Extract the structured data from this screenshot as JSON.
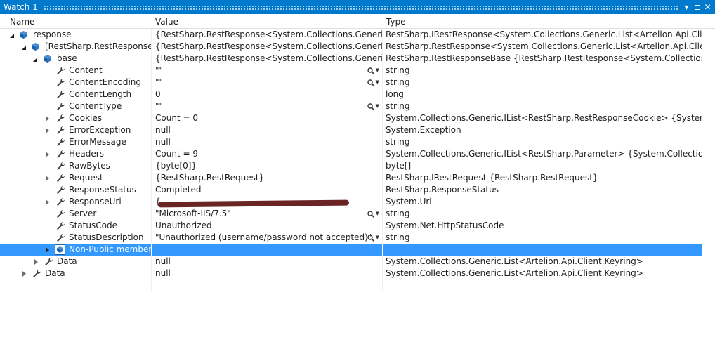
{
  "window": {
    "title": "Watch 1"
  },
  "columns": {
    "name": "Name",
    "value": "Value",
    "type": "Type"
  },
  "rows": [
    {
      "name": "response",
      "value": "{RestSharp.RestResponse<System.Collections.Generic.List<Ar",
      "type": "RestSharp.IRestResponse<System.Collections.Generic.List<Artelion.Api.Client.Keyring"
    },
    {
      "name": "[RestSharp.RestResponse<Sy",
      "value": "{RestSharp.RestResponse<System.Collections.Generic.List<Ar",
      "type": "RestSharp.RestResponse<System.Collections.Generic.List<Artelion.Api.Client.Keyring>"
    },
    {
      "name": "base",
      "value": "{RestSharp.RestResponse<System.Collections.Generic.List<Ar",
      "type": "RestSharp.RestResponseBase {RestSharp.RestResponse<System.Collections.Generic.List<"
    },
    {
      "name": "Content",
      "value": "\"\"",
      "type": "string"
    },
    {
      "name": "ContentEncoding",
      "value": "\"\"",
      "type": "string"
    },
    {
      "name": "ContentLength",
      "value": "0",
      "type": "long"
    },
    {
      "name": "ContentType",
      "value": "\"\"",
      "type": "string"
    },
    {
      "name": "Cookies",
      "value": "Count = 0",
      "type": "System.Collections.Generic.IList<RestSharp.RestResponseCookie> {System.Collections"
    },
    {
      "name": "ErrorException",
      "value": "null",
      "type": "System.Exception"
    },
    {
      "name": "ErrorMessage",
      "value": "null",
      "type": "string"
    },
    {
      "name": "Headers",
      "value": "Count = 9",
      "type": "System.Collections.Generic.IList<RestSharp.Parameter> {System.Collections.Generic.L"
    },
    {
      "name": "RawBytes",
      "value": "{byte[0]}",
      "type": "byte[]"
    },
    {
      "name": "Request",
      "value": "{RestSharp.RestRequest}",
      "type": "RestSharp.IRestRequest {RestSharp.RestRequest}"
    },
    {
      "name": "ResponseStatus",
      "value": "Completed",
      "type": "RestSharp.ResponseStatus"
    },
    {
      "name": "ResponseUri",
      "value": "{",
      "type": "System.Uri"
    },
    {
      "name": "Server",
      "value": "\"Microsoft-IIS/7.5\"",
      "type": "string"
    },
    {
      "name": "StatusCode",
      "value": "Unauthorized",
      "type": "System.Net.HttpStatusCode"
    },
    {
      "name": "StatusDescription",
      "value": "\"Unauthorized (username/password not accepted)\"",
      "type": "string"
    },
    {
      "name": "Non-Public members",
      "value": "",
      "type": ""
    },
    {
      "name": "Data",
      "value": "null",
      "type": "System.Collections.Generic.List<Artelion.Api.Client.Keyring>"
    },
    {
      "name": "Data",
      "value": "null",
      "type": "System.Collections.Generic.List<Artelion.Api.Client.Keyring>"
    }
  ],
  "colors": {
    "titlebar": "#007acc",
    "selection": "#3399ff",
    "object_icon": "#1c5fa8",
    "property_icon": "#3c3c3c"
  },
  "icons": {
    "object": "cube-icon",
    "property": "wrench-icon",
    "magnifier": "magnifier-icon"
  }
}
